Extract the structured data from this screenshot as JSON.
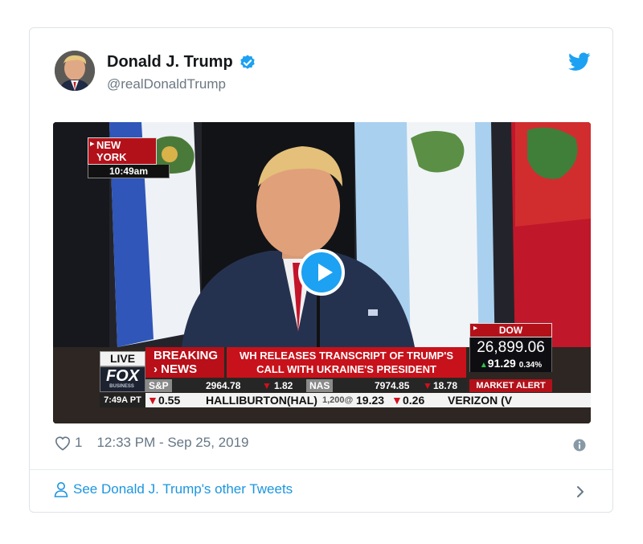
{
  "author": {
    "name": "Donald J. Trump",
    "handle": "@realDonaldTrump",
    "verified_icon": "verified-badge-icon"
  },
  "media": {
    "location": "NEW YORK",
    "location_time": "10:49am",
    "live_label": "LIVE",
    "breaking_line1": "BREAKING",
    "breaking_line2": "› NEWS",
    "headline_line1": "WH RELEASES TRANSCRIPT OF TRUMP'S",
    "headline_line2": "CALL WITH UKRAINE'S PRESIDENT",
    "channel": "FOX",
    "channel_sub": "BUSINESS",
    "clock": "7:49A PT",
    "dow": {
      "label": "DOW",
      "value": "26,899.06",
      "change": "91.29",
      "change_pct": "0.34%"
    },
    "market_alert": "MARKET ALERT",
    "ticker_top": {
      "sp_label": "S&P",
      "sp_value": "2964.78",
      "sp_change": "1.82",
      "nas_label": "NAS",
      "nas_value": "7974.85",
      "nas_change": "18.78"
    },
    "ticker_bottom": {
      "lead_change": "0.55",
      "stock": "HALLIBURTON(HAL)",
      "stock_qty": "1,200@",
      "stock_price": "19.23",
      "stock_change": "0.26",
      "next": "VERIZON (V"
    }
  },
  "footer": {
    "likes": "1",
    "timestamp": "12:33 PM - Sep 25, 2019",
    "other_tweets_link": "See Donald J. Trump's other Tweets"
  },
  "colors": {
    "twitter_blue": "#1da1f2",
    "link_blue": "#1b95e0",
    "fox_red": "#c8121b"
  }
}
